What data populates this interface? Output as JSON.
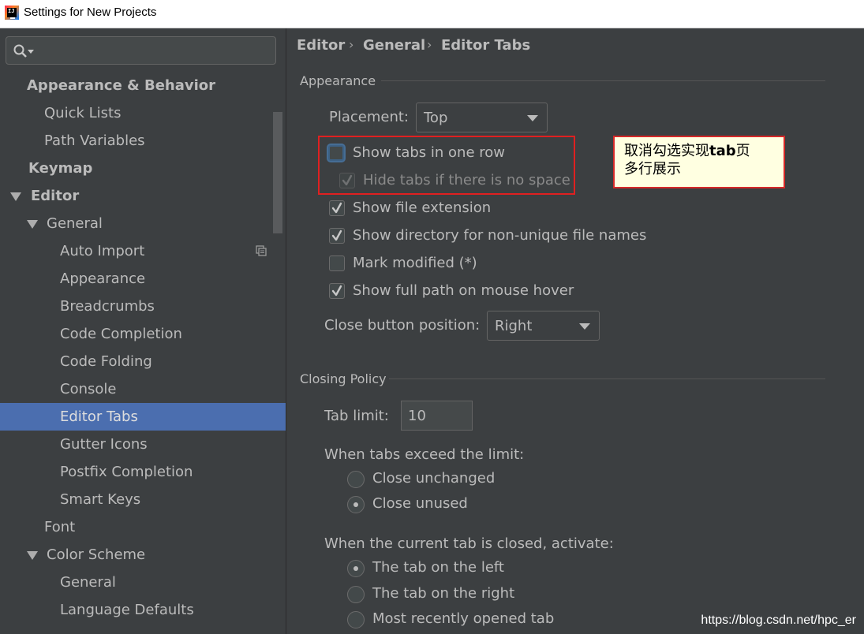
{
  "window": {
    "title": "Settings for New Projects",
    "app_icon": "intellij-idea-icon"
  },
  "search": {
    "icon": "search-icon",
    "value": ""
  },
  "sidebar": {
    "items": [
      {
        "label": "Appearance & Behavior",
        "level": 0,
        "bold": true,
        "expanded": null,
        "selected": false
      },
      {
        "label": "Quick Lists",
        "level": 1,
        "bold": false,
        "expanded": null,
        "selected": false
      },
      {
        "label": "Path Variables",
        "level": 1,
        "bold": false,
        "expanded": null,
        "selected": false
      },
      {
        "label": "Keymap",
        "level": 0,
        "bold": true,
        "expanded": null,
        "selected": false
      },
      {
        "label": "Editor",
        "level": 0,
        "bold": true,
        "expanded": true,
        "selected": false
      },
      {
        "label": "General",
        "level": 1,
        "bold": false,
        "expanded": true,
        "selected": false
      },
      {
        "label": "Auto Import",
        "level": 2,
        "bold": false,
        "expanded": null,
        "selected": false,
        "badge_icon": "project-scope-icon"
      },
      {
        "label": "Appearance",
        "level": 2,
        "bold": false,
        "expanded": null,
        "selected": false
      },
      {
        "label": "Breadcrumbs",
        "level": 2,
        "bold": false,
        "expanded": null,
        "selected": false
      },
      {
        "label": "Code Completion",
        "level": 2,
        "bold": false,
        "expanded": null,
        "selected": false
      },
      {
        "label": "Code Folding",
        "level": 2,
        "bold": false,
        "expanded": null,
        "selected": false
      },
      {
        "label": "Console",
        "level": 2,
        "bold": false,
        "expanded": null,
        "selected": false
      },
      {
        "label": "Editor Tabs",
        "level": 2,
        "bold": false,
        "expanded": null,
        "selected": true
      },
      {
        "label": "Gutter Icons",
        "level": 2,
        "bold": false,
        "expanded": null,
        "selected": false
      },
      {
        "label": "Postfix Completion",
        "level": 2,
        "bold": false,
        "expanded": null,
        "selected": false
      },
      {
        "label": "Smart Keys",
        "level": 2,
        "bold": false,
        "expanded": null,
        "selected": false
      },
      {
        "label": "Font",
        "level": 1,
        "bold": false,
        "expanded": null,
        "selected": false
      },
      {
        "label": "Color Scheme",
        "level": 1,
        "bold": false,
        "expanded": true,
        "selected": false
      },
      {
        "label": "General",
        "level": 2,
        "bold": false,
        "expanded": null,
        "selected": false
      },
      {
        "label": "Language Defaults",
        "level": 2,
        "bold": false,
        "expanded": null,
        "selected": false
      }
    ]
  },
  "breadcrumb": {
    "items": [
      "Editor",
      "General",
      "Editor Tabs"
    ],
    "separator": "›"
  },
  "appearance": {
    "title": "Appearance",
    "placement_label": "Placement:",
    "placement_value": "Top",
    "options": [
      {
        "label": "Show tabs in one row",
        "checked": false,
        "disabled": false,
        "focused": true
      },
      {
        "label": "Hide tabs if there is no space",
        "checked": true,
        "disabled": true,
        "focused": false
      },
      {
        "label": "Show file extension",
        "checked": true,
        "disabled": false,
        "focused": false
      },
      {
        "label": "Show directory for non-unique file names",
        "checked": true,
        "disabled": false,
        "focused": false
      },
      {
        "label": "Mark modified (*)",
        "checked": false,
        "disabled": false,
        "focused": false
      },
      {
        "label": "Show full path on mouse hover",
        "checked": true,
        "disabled": false,
        "focused": false
      }
    ],
    "close_button_label": "Close button position:",
    "close_button_value": "Right"
  },
  "closing_policy": {
    "title": "Closing Policy",
    "tab_limit_label": "Tab limit:",
    "tab_limit_value": "10",
    "exceed_label": "When tabs exceed the limit:",
    "exceed_options": [
      {
        "label": "Close unchanged",
        "selected": false
      },
      {
        "label": "Close unused",
        "selected": true
      }
    ],
    "activate_label": "When the current tab is closed, activate:",
    "activate_options": [
      {
        "label": "The tab on the left",
        "selected": true
      },
      {
        "label": "The tab on the right",
        "selected": false
      },
      {
        "label": "Most recently opened tab",
        "selected": false
      }
    ]
  },
  "annotation": {
    "callout_line1_a": "取消勾选实现",
    "callout_line1_b": "tab",
    "callout_line1_c": "页",
    "callout_line2": "多行展示",
    "highlight_color": "#e02020"
  },
  "watermark": "https://blog.csdn.net/hpc_er",
  "colors": {
    "background": "#3c3f41",
    "selection": "#4b6eaf",
    "text": "#bbbbbb",
    "callout_bg": "#ffffe1"
  }
}
